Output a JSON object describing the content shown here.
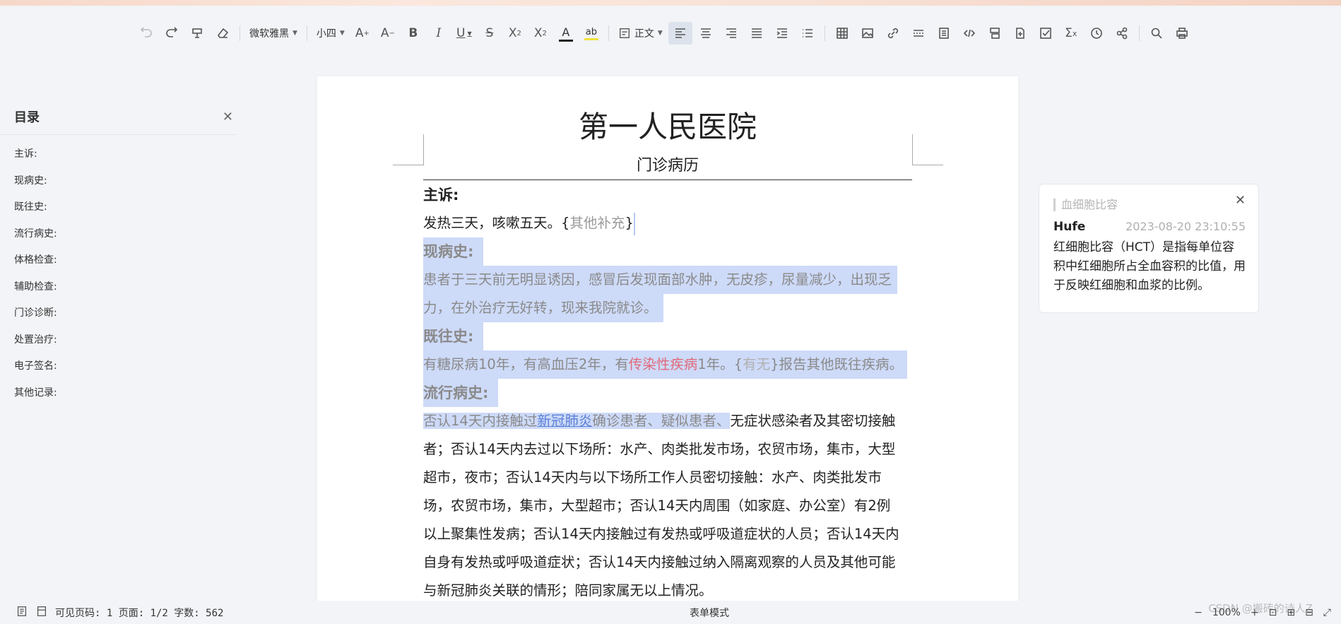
{
  "toolbar": {
    "font_name": "微软雅黑",
    "font_size": "小四",
    "paragraph_style": "正文",
    "buttons": [
      "undo-icon",
      "redo-icon",
      "format-painter-icon",
      "eraser-icon",
      "increase-font-icon",
      "decrease-font-icon",
      "bold-icon",
      "italic-icon",
      "underline-icon",
      "strikethrough-icon",
      "superscript-icon",
      "subscript-icon",
      "font-color-icon",
      "highlight-icon",
      "align-left-icon",
      "align-center-icon",
      "align-right-icon",
      "justify-icon",
      "indent-icon",
      "list-icon",
      "table-icon",
      "image-icon",
      "link-icon",
      "separator-icon",
      "page-break-icon",
      "code-icon",
      "print-layout-icon",
      "new-page-icon",
      "checkbox-icon",
      "formula-icon",
      "date-icon",
      "control-icon",
      "search-icon",
      "print-icon"
    ]
  },
  "toc": {
    "title": "目录",
    "items": [
      "主诉:",
      "现病史:",
      "既往史:",
      "流行病史:",
      "体格检查:",
      "辅助检查:",
      "门诊诊断:",
      "处置治疗:",
      "电子签名:",
      "其他记录:"
    ]
  },
  "document": {
    "title": "第一人民医院",
    "subtitle": "门诊病历",
    "s1_heading": "主诉:",
    "s1_text": "发热三天，咳嗽五天。{",
    "s1_placeholder": "其他补充",
    "s1_close": "}",
    "s2_heading": "现病史:",
    "s2_line1": "患者于三天前无明显诱因，感冒后发现面部水肿，无皮疹，尿量减少，出现乏",
    "s2_line2": "力，在外治疗无好转，现来我院就诊。",
    "s3_heading": "既往史:",
    "s3_a": "有糖尿病10年，有高血压2年，有",
    "s3_red": "传染性疾病",
    "s3_b": "1年。{",
    "s3_placeholder": "有无",
    "s3_c": "}报告其他既往疾病。",
    "s4_heading": "流行病史:",
    "s4_a": "否认14天内接触过",
    "s4_link": "新冠肺炎",
    "s4_b": "确诊患者、疑似患者、",
    "s4_c": "无症状感染者及其密切接触",
    "s4_lines": [
      "者；否认14天内去过以下场所：水产、肉类批发市场，农贸市场，集市，大型",
      "超市，夜市；否认14天内与以下场所工作人员密切接触：水产、肉类批发市",
      "场，农贸市场，集市，大型超市；否认14天内周围（如家庭、办公室）有2例",
      "以上聚集性发病；否认14天内接触过有发热或呼吸道症状的人员；否认14天内",
      "自身有发热或呼吸道症状；否认14天内接触过纳入隔离观察的人员及其他可能",
      "与新冠肺炎关联的情形；陪同家属无以上情况。"
    ]
  },
  "comment": {
    "quote": "血细胞比容",
    "author": "Hufe",
    "time": "2023-08-20 23:10:55",
    "body": "红细胞比容（HCT）是指每单位容积中红细胞所占全血容积的比值，用于反映红细胞和血浆的比例。"
  },
  "statusbar": {
    "stats": "可见页码: 1 页面: 1/2 字数: 562",
    "mode": "表单模式",
    "zoom": "100%",
    "watermark": "CSDN @搬砖的诗人Z"
  }
}
